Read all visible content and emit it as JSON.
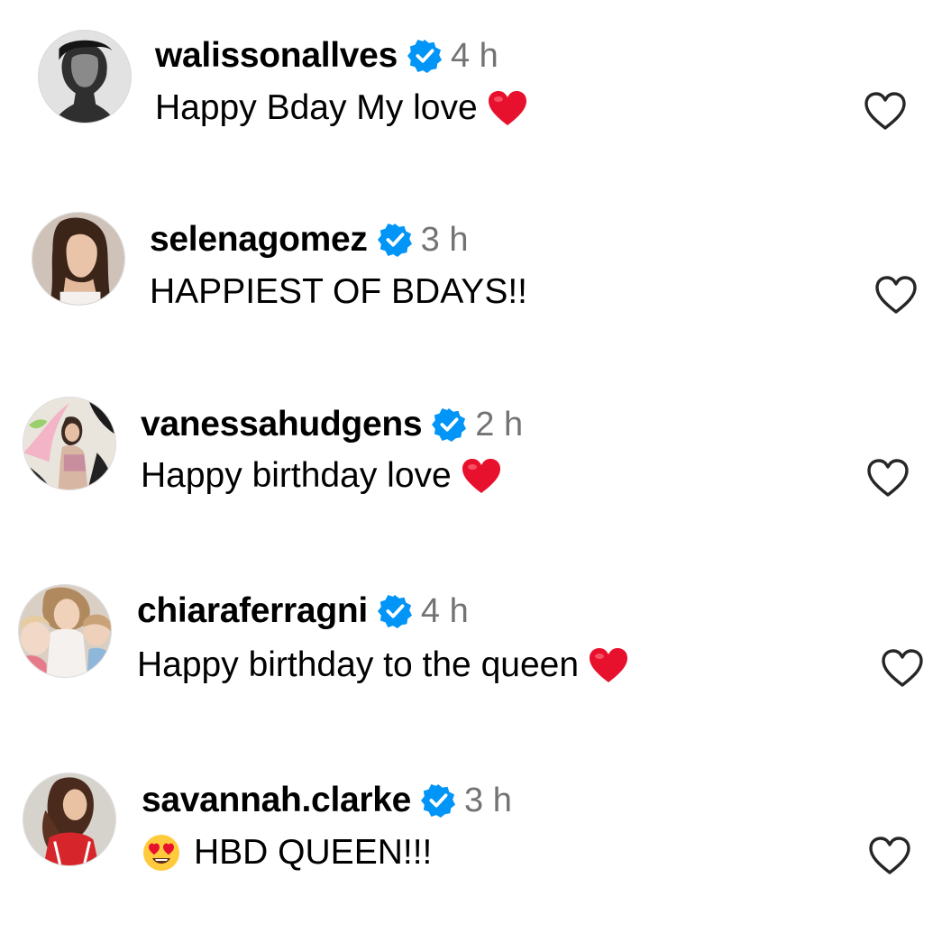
{
  "comments": [
    {
      "username": "walissonallves",
      "verified": true,
      "time": "4 h",
      "text": "Happy Bday My love",
      "emoji": "red-heart-emoji",
      "liked": false
    },
    {
      "username": "selenagomez",
      "verified": true,
      "time": "3 h",
      "text": "HAPPIEST OF BDAYS!!",
      "emoji": "",
      "liked": false
    },
    {
      "username": "vanessahudgens",
      "verified": true,
      "time": "2 h",
      "text": "Happy birthday love",
      "emoji": "red-heart-emoji",
      "liked": false
    },
    {
      "username": "chiaraferragni",
      "verified": true,
      "time": "4 h",
      "text": "Happy birthday to the queen",
      "emoji": "red-heart-emoji",
      "liked": false
    },
    {
      "username": "savannah.clarke",
      "verified": true,
      "time": "3 h",
      "text": "HBD QUEEN!!!",
      "emoji": "heart-eyes-emoji",
      "liked": false
    }
  ],
  "colors": {
    "verified_badge": "#0095f6",
    "timestamp": "#737373",
    "heart_emoji": "#e8112d",
    "like_outline": "#262626"
  }
}
